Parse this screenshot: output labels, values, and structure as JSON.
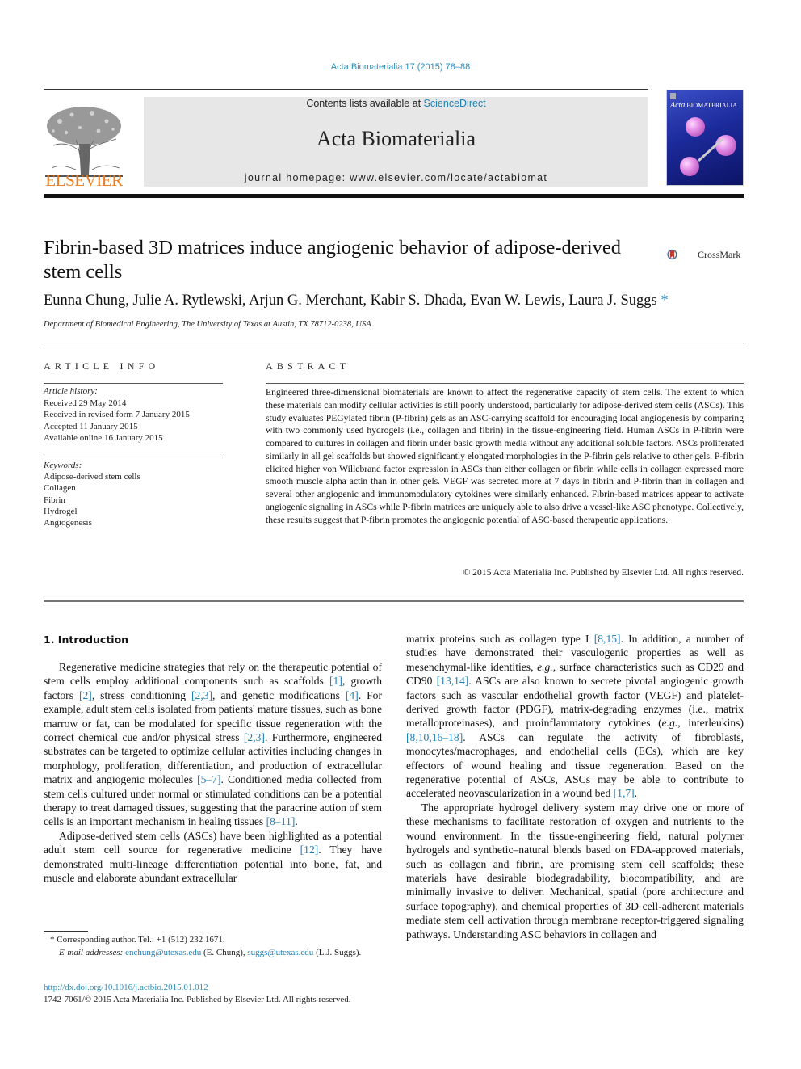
{
  "header": {
    "journal_ref": "Acta Biomaterialia 17 (2015) 78–88",
    "contents_prefix": "Contents lists available at ",
    "contents_link": "ScienceDirect",
    "journal_name": "Acta Biomaterialia",
    "homepage_prefix": "journal homepage: ",
    "homepage_url": "www.elsevier.com/locate/actabiomat",
    "publisher_logo_text": "ELSEVIER",
    "cover_title_a": "Acta",
    "cover_title_b": " BIOMATERIALIA",
    "crossmark_label": "CrossMark"
  },
  "colors": {
    "link": "#1f7fb4",
    "elsevier_orange": "#f07c1c",
    "banner_gray": "#e7e7e7"
  },
  "article": {
    "title": "Fibrin-based 3D matrices induce angiogenic behavior of adipose-derived stem cells",
    "authors": "Eunna Chung, Julie A. Rytlewski, Arjun G. Merchant, Kabir S. Dhada, Evan W. Lewis, Laura J. Suggs",
    "corresponding_mark": "*",
    "affiliation": "Department of Biomedical Engineering, The University of Texas at Austin, TX 78712-0238, USA"
  },
  "article_info": {
    "heading": "ARTICLE INFO",
    "history_label": "Article history:",
    "history": [
      "Received 29 May 2014",
      "Received in revised form 7 January 2015",
      "Accepted 11 January 2015",
      "Available online 16 January 2015"
    ],
    "keywords_label": "Keywords:",
    "keywords": [
      "Adipose-derived stem cells",
      "Collagen",
      "Fibrin",
      "Hydrogel",
      "Angiogenesis"
    ]
  },
  "abstract": {
    "heading": "ABSTRACT",
    "text": "Engineered three-dimensional biomaterials are known to affect the regenerative capacity of stem cells. The extent to which these materials can modify cellular activities is still poorly understood, particularly for adipose-derived stem cells (ASCs). This study evaluates PEGylated fibrin (P-fibrin) gels as an ASC-carrying scaffold for encouraging local angiogenesis by comparing with two commonly used hydrogels (i.e., collagen and fibrin) in the tissue-engineering field. Human ASCs in P-fibrin were compared to cultures in collagen and fibrin under basic growth media without any additional soluble factors. ASCs proliferated similarly in all gel scaffolds but showed significantly elongated morphologies in the P-fibrin gels relative to other gels. P-fibrin elicited higher von Willebrand factor expression in ASCs than either collagen or fibrin while cells in collagen expressed more smooth muscle alpha actin than in other gels. VEGF was secreted more at 7 days in fibrin and P-fibrin than in collagen and several other angiogenic and immunomodulatory cytokines were similarly enhanced. Fibrin-based matrices appear to activate angiogenic signaling in ASCs while P-fibrin matrices are uniquely able to also drive a vessel-like ASC phenotype. Collectively, these results suggest that P-fibrin promotes the angiogenic potential of ASC-based therapeutic applications.",
    "copyright": "© 2015 Acta Materialia Inc. Published by Elsevier Ltd. All rights reserved."
  },
  "introduction": {
    "heading": "1. Introduction",
    "p1": [
      {
        "t": "Regenerative medicine strategies that rely on the therapeutic potential of stem cells employ additional components such as scaffolds "
      },
      {
        "ref": "[1]"
      },
      {
        "t": ", growth factors "
      },
      {
        "ref": "[2]"
      },
      {
        "t": ", stress conditioning "
      },
      {
        "ref": "[2,3]"
      },
      {
        "t": ", and genetic modifications "
      },
      {
        "ref": "[4]"
      },
      {
        "t": ". For example, adult stem cells isolated from patients' mature tissues, such as bone marrow or fat, can be modulated for specific tissue regeneration with the correct chemical cue and/or physical stress "
      },
      {
        "ref": "[2,3]"
      },
      {
        "t": ". Furthermore, engineered substrates can be targeted to optimize cellular activities including changes in morphology, proliferation, differentiation, and production of extracellular matrix and angiogenic molecules "
      },
      {
        "ref": "[5–7]"
      },
      {
        "t": ". Conditioned media collected from stem cells cultured under normal or stimulated conditions can be a potential therapy to treat damaged tissues, suggesting that the paracrine action of stem cells is an important mechanism in healing tissues "
      },
      {
        "ref": "[8–11]"
      },
      {
        "t": "."
      }
    ],
    "p2": [
      {
        "t": "Adipose-derived stem cells (ASCs) have been highlighted as a potential adult stem cell source for regenerative medicine "
      },
      {
        "ref": "[12]"
      },
      {
        "t": ". They have demonstrated multi-lineage differentiation potential into bone, fat, and muscle and elaborate abundant extracellular "
      }
    ],
    "p2_cont": [
      {
        "t": "matrix proteins such as collagen type I "
      },
      {
        "ref": "[8,15]"
      },
      {
        "t": ". In addition, a number of studies have demonstrated their vasculogenic properties as well as mesenchymal-like identities, "
      },
      {
        "i": "e.g."
      },
      {
        "t": ", surface characteristics such as CD29 and CD90 "
      },
      {
        "ref": "[13,14]"
      },
      {
        "t": ". ASCs are also known to secrete pivotal angiogenic growth factors such as vascular endothelial growth factor (VEGF) and platelet-derived growth factor (PDGF), matrix-degrading enzymes (i.e., matrix metalloproteinases), and proinflammatory cytokines ("
      },
      {
        "i": "e.g."
      },
      {
        "t": ", interleukins) "
      },
      {
        "ref": "[8,10,16–18]"
      },
      {
        "t": ". ASCs can regulate the activity of fibroblasts, monocytes/macrophages, and endothelial cells (ECs), which are key effectors of wound healing and tissue regeneration. Based on the regenerative potential of ASCs, ASCs may be able to contribute to accelerated neovascularization in a wound bed "
      },
      {
        "ref": "[1,7]"
      },
      {
        "t": "."
      }
    ],
    "p3": [
      {
        "t": "The appropriate hydrogel delivery system may drive one or more of these mechanisms to facilitate restoration of oxygen and nutrients to the wound environment. In the tissue-engineering field, natural polymer hydrogels and synthetic–natural blends based on FDA-approved materials, such as collagen and fibrin, are promising stem cell scaffolds; these materials have desirable biodegradability, biocompatibility, and are minimally invasive to deliver. Mechanical, spatial (pore architecture and surface topography), and chemical properties of 3D cell-adherent materials mediate stem cell activation through membrane receptor-triggered signaling pathways. Understanding ASC behaviors in collagen and"
      }
    ]
  },
  "footnotes": {
    "corresponding": "* Corresponding author. Tel.: +1 (512) 232 1671.",
    "email_label": "E-mail addresses: ",
    "email1": "enchung@utexas.edu",
    "email1_name": " (E. Chung), ",
    "email2": "suggs@utexas.edu",
    "email2_name": " (L.J. Suggs).",
    "doi": "http://dx.doi.org/10.1016/j.actbio.2015.01.012",
    "issn_line": "1742-7061/© 2015 Acta Materialia Inc. Published by Elsevier Ltd. All rights reserved."
  }
}
